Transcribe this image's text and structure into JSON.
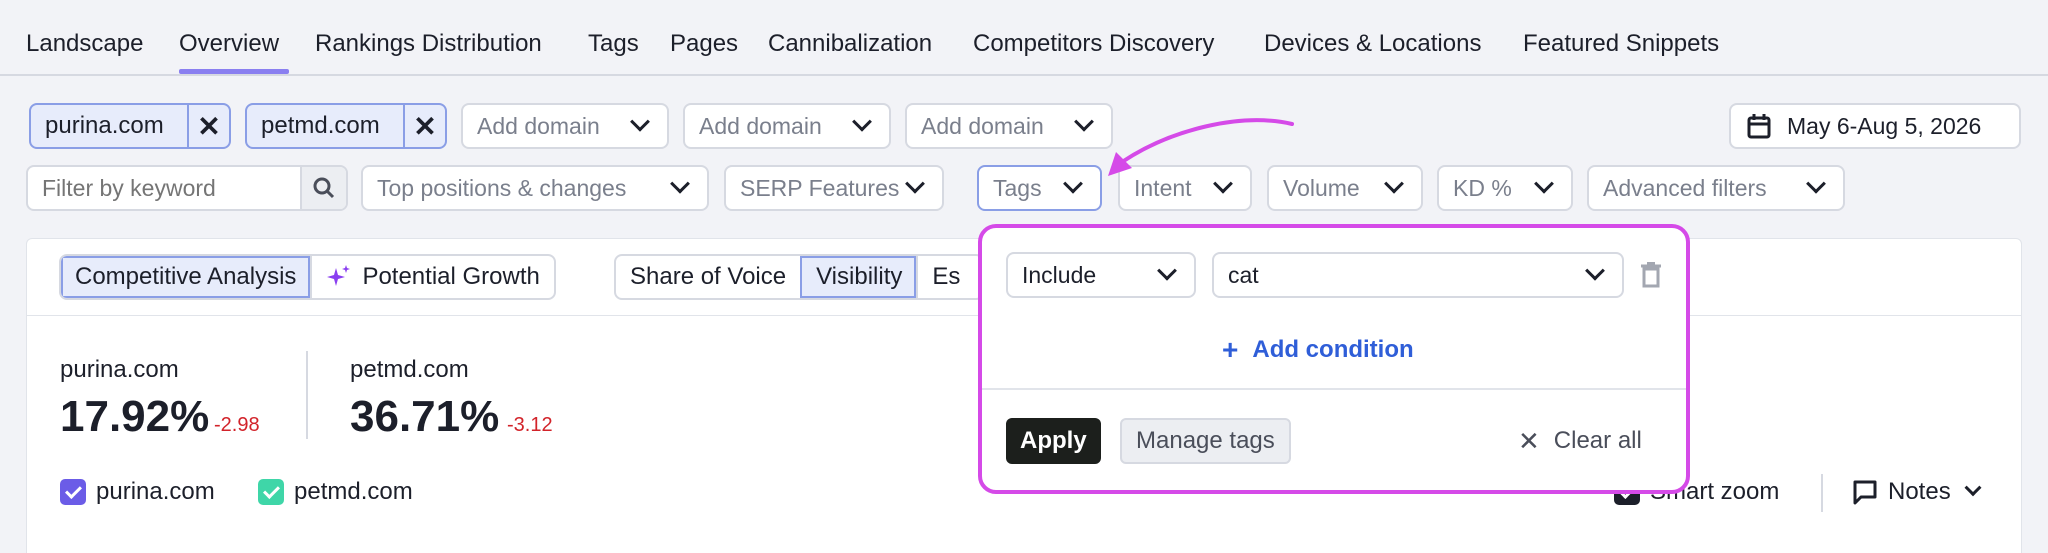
{
  "tabs": [
    {
      "label": "Landscape"
    },
    {
      "label": "Overview"
    },
    {
      "label": "Rankings Distribution"
    },
    {
      "label": "Tags"
    },
    {
      "label": "Pages"
    },
    {
      "label": "Cannibalization"
    },
    {
      "label": "Competitors Discovery"
    },
    {
      "label": "Devices & Locations"
    },
    {
      "label": "Featured Snippets"
    }
  ],
  "domains": {
    "chips": [
      {
        "name": "purina.com"
      },
      {
        "name": "petmd.com"
      }
    ],
    "add_placeholders": [
      "Add domain",
      "Add domain",
      "Add domain"
    ]
  },
  "date_range": "May 6-Aug 5, 2026",
  "filters": {
    "keyword_placeholder": "Filter by keyword",
    "top_positions": "Top positions & changes",
    "serp_features": "SERP Features",
    "tags": "Tags",
    "intent": "Intent",
    "volume": "Volume",
    "kd": "KD %",
    "advanced": "Advanced filters"
  },
  "card": {
    "mode_tabs": [
      {
        "label": "Competitive Analysis"
      },
      {
        "label": "Potential Growth"
      }
    ],
    "metric_tabs": [
      {
        "label": "Share of Voice"
      },
      {
        "label": "Visibility"
      },
      {
        "label": "Es"
      }
    ],
    "metrics": [
      {
        "domain": "purina.com",
        "value": "17.92%",
        "delta": "-2.98"
      },
      {
        "domain": "petmd.com",
        "value": "36.71%",
        "delta": "-3.12"
      }
    ],
    "legend": [
      {
        "label": "purina.com",
        "color": "#6b5ce7"
      },
      {
        "label": "petmd.com",
        "color": "#3fd6a8"
      }
    ],
    "smart_zoom": "Smart zoom",
    "notes": "Notes"
  },
  "popover": {
    "condition_type": "Include",
    "tag_value": "cat",
    "add_condition": "Add condition",
    "apply": "Apply",
    "manage_tags": "Manage tags",
    "clear_all": "Clear all"
  },
  "colors": {
    "accent": "#8a7ff0",
    "popover_border": "#d54ae8",
    "link": "#2f5ed8",
    "delta_negative": "#d2232a"
  }
}
